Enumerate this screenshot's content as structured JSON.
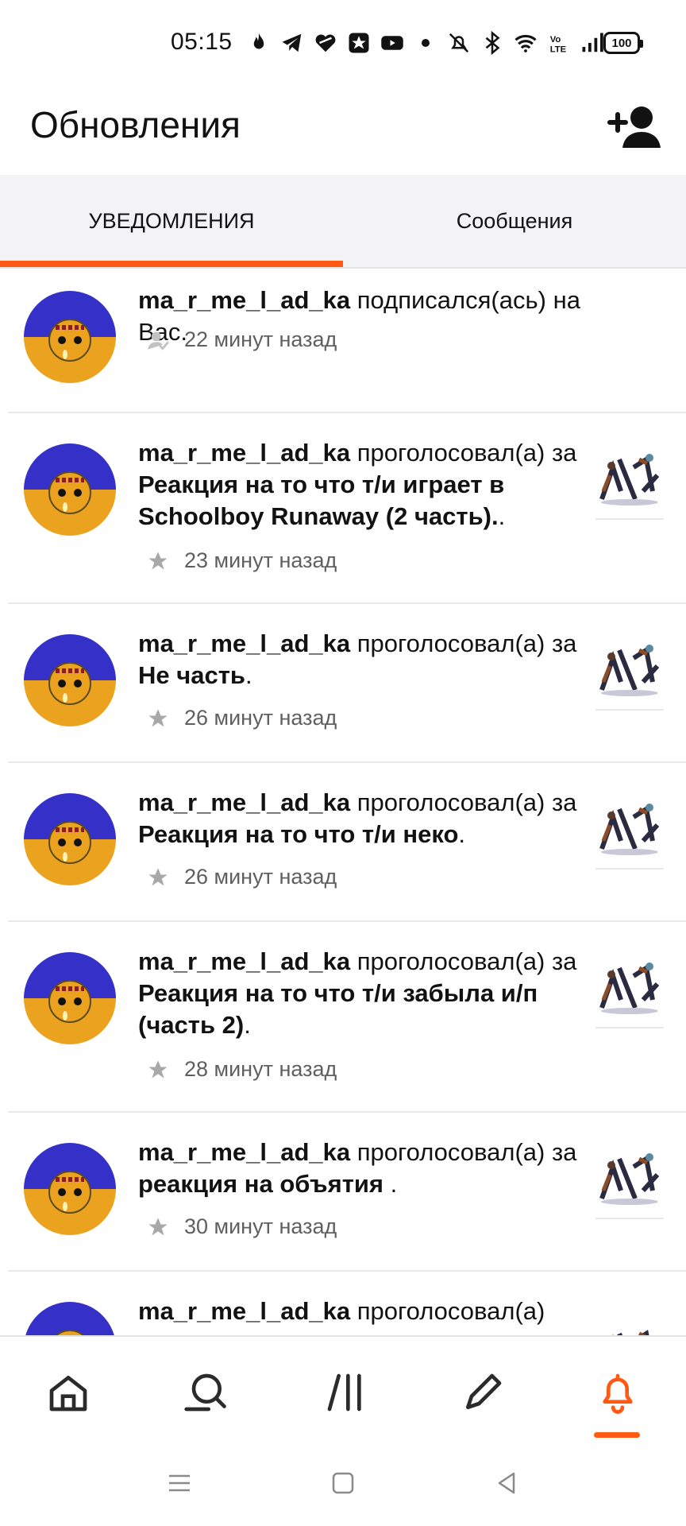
{
  "status_bar": {
    "time": "05:15",
    "battery": "100",
    "icons": [
      "flame-icon",
      "telegram-icon",
      "heart-badge-icon",
      "star-box-icon",
      "youtube-icon",
      "dot-icon",
      "bell-off-icon",
      "bluetooth-icon",
      "wifi-icon",
      "volte-icon",
      "signal-icon"
    ]
  },
  "header": {
    "title": "Обновления",
    "add_user_icon": "add-user-icon"
  },
  "tabs": [
    {
      "label": "УВЕДОМЛЕНИЯ",
      "active": true
    },
    {
      "label": "Сообщения",
      "active": false
    }
  ],
  "notifications": [
    {
      "username": "ma_r_me_l_ad_ka",
      "action": " подписался(ась) на Вас.",
      "title": "",
      "title_suffix": "",
      "time": "22 минут назад",
      "type": "follow",
      "icon": "follower-icon"
    },
    {
      "username": "ma_r_me_l_ad_ka",
      "action": " проголосовал(а) за ",
      "title": "Реакция на то что т/и играет в Schoolboy Runaway (2 часть).",
      "title_suffix": ".",
      "time": "23 минут назад",
      "type": "vote",
      "icon": "star-icon"
    },
    {
      "username": "ma_r_me_l_ad_ka",
      "action": " проголосовал(а) за ",
      "title": "Не часть",
      "title_suffix": ".",
      "time": "26 минут назад",
      "type": "vote",
      "icon": "star-icon"
    },
    {
      "username": "ma_r_me_l_ad_ka",
      "action": " проголосовал(а) за ",
      "title": "Реакция на то что т/и неко",
      "title_suffix": ".",
      "time": "26 минут назад",
      "type": "vote",
      "icon": "star-icon"
    },
    {
      "username": "ma_r_me_l_ad_ka",
      "action": " проголосовал(а) за ",
      "title": "Реакция на то что т/и забыла и/п (часть 2)",
      "title_suffix": ".",
      "time": "28 минут назад",
      "type": "vote",
      "icon": "star-icon"
    },
    {
      "username": "ma_r_me_l_ad_ka",
      "action": " проголосовал(а) за ",
      "title": "реакция на объятия ",
      "title_suffix": ".",
      "time": "30 минут назад",
      "type": "vote",
      "icon": "star-icon"
    },
    {
      "username": "ma_r_me_l_ad_ka",
      "action": " проголосовал(а)",
      "title": "",
      "title_suffix": "",
      "time": "",
      "type": "vote",
      "icon": "star-icon"
    }
  ],
  "bottom_nav": [
    {
      "icon": "home-icon",
      "active": false
    },
    {
      "icon": "search-icon",
      "active": false
    },
    {
      "icon": "library-icon",
      "active": false
    },
    {
      "icon": "write-icon",
      "active": false
    },
    {
      "icon": "bell-icon",
      "active": true
    }
  ],
  "system_nav": [
    "menu-icon",
    "home-square-icon",
    "back-icon"
  ],
  "colors": {
    "accent": "#ff5a14",
    "avatar_top": "#3530c8",
    "avatar_bottom": "#eba21f",
    "meta_text": "#5f5f5f"
  }
}
